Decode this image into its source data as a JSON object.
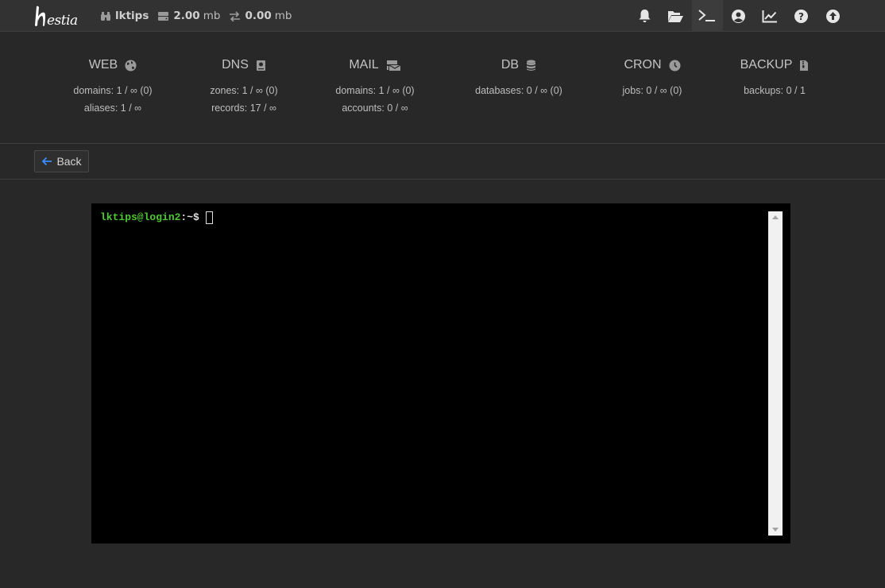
{
  "brand": {
    "logo_text": "hestia"
  },
  "topbar": {
    "user": "lktips",
    "disk": "2.00",
    "disk_unit": "mb",
    "bandwidth": "0.00",
    "bandwidth_unit": "mb",
    "icons": [
      "bell-icon",
      "folder-open-icon",
      "terminal-icon",
      "user-circle-icon",
      "chart-line-icon",
      "help-icon",
      "upgrade-icon"
    ],
    "active_icon": "terminal-icon"
  },
  "stats": {
    "web": {
      "title": "WEB",
      "icon": "globe-icon",
      "line1": "domains: 1 / ∞ (0)",
      "line2": "aliases: 1 / ∞"
    },
    "dns": {
      "title": "DNS",
      "icon": "book-icon",
      "line1": "zones: 1 / ∞ (0)",
      "line2": "records: 17 / ∞"
    },
    "mail": {
      "title": "MAIL",
      "icon": "mail-bulk-icon",
      "line1": "domains: 1 / ∞ (0)",
      "line2": "accounts: 0 / ∞"
    },
    "db": {
      "title": "DB",
      "icon": "database-icon",
      "line1": "databases: 0 / ∞ (0)"
    },
    "cron": {
      "title": "CRON",
      "icon": "clock-icon",
      "line1": "jobs: 0 / ∞ (0)"
    },
    "backup": {
      "title": "BACKUP",
      "icon": "file-archive-icon",
      "line1": "backups: 0 / 1"
    }
  },
  "toolbar": {
    "back_label": "Back"
  },
  "terminal": {
    "prompt_user": "lktips@login2",
    "prompt_rest": ":~$"
  },
  "colors": {
    "accent_blue": "#3a8bff",
    "prompt_green": "#4ec932",
    "background": "#282828"
  }
}
